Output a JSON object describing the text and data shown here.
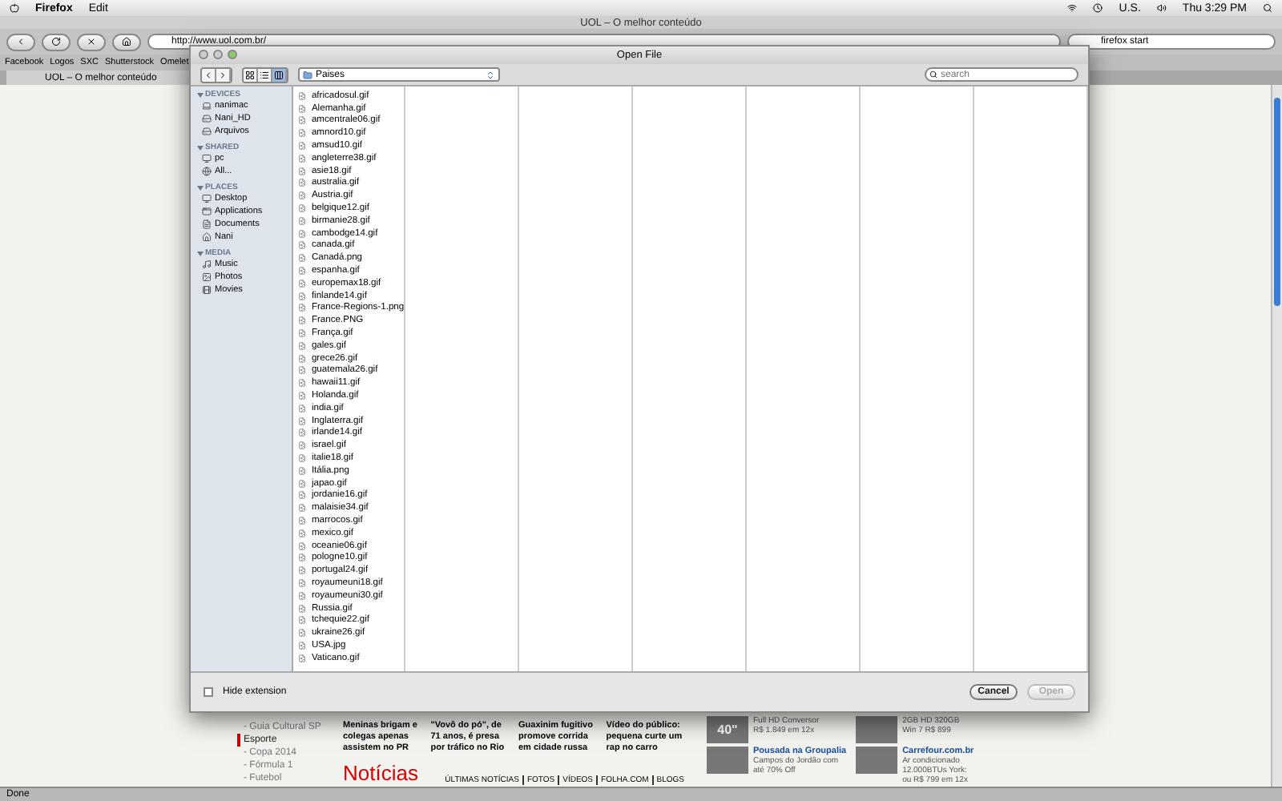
{
  "menubar": {
    "app": "Firefox",
    "menus": [
      "Edit"
    ],
    "input_source": "U.S.",
    "clock": "Thu 3:29 PM"
  },
  "browser": {
    "title": "UOL – O melhor conteúdo",
    "url": "http://www.uol.com.br/",
    "search_value": "firefox start",
    "bookmarks": [
      "Facebook",
      "Logos",
      "SXC",
      "Shutterstock",
      "Omelet"
    ],
    "tabs": [
      {
        "label": "UOL – O melhor conteúdo",
        "selected": true
      }
    ],
    "status": "Done"
  },
  "page": {
    "nav": [
      {
        "label": "- Guia Cultural SP",
        "kind": "sub"
      },
      {
        "label": "Esporte",
        "kind": "section"
      },
      {
        "label": "- Copa 2014",
        "kind": "sub"
      },
      {
        "label": "- Fórmula 1",
        "kind": "sub"
      },
      {
        "label": "- Futebol",
        "kind": "sub"
      }
    ],
    "stories": [
      "Meninas brigam e colegas apenas assistem no PR",
      "\"Vovô do pó\", de 71 anos, é presa por tráfico no Rio",
      "Guaxinim fugitivo promove corrida em cidade russa",
      "Vídeo do público: pequena curte um rap no carro"
    ],
    "section_title": "Notícias",
    "section_links": [
      "ÚLTIMAS NOTÍCIAS",
      "FOTOS",
      "VÍDEOS",
      "FOLHA.COM",
      "BLOGS"
    ],
    "ads": [
      {
        "badge": "40\"",
        "lines": [
          "Full HD Conversor",
          "R$ 1.849 em 12x"
        ]
      },
      {
        "lines": [
          "2GB HD 320GB",
          "Win 7 R$ 899"
        ]
      },
      {
        "title": "Pousada na Groupalia",
        "lines": [
          "Campos do Jordão com até 70% Off"
        ]
      },
      {
        "title": "Carrefour.com.br",
        "lines": [
          "Ar condicionado 12.000BTUs York: ou R$ 799 em 12x"
        ]
      }
    ]
  },
  "dialog": {
    "title": "Open File",
    "view_buttons": [
      {
        "kind": "icon",
        "selected": false
      },
      {
        "kind": "list",
        "selected": false
      },
      {
        "kind": "column",
        "selected": true
      }
    ],
    "location": "Paises",
    "search": {
      "placeholder": "search"
    },
    "sidebar": [
      {
        "heading": "DEVICES",
        "expanded": true,
        "items": [
          {
            "label": "nanimac",
            "kind": "computer"
          },
          {
            "label": "Nani_HD",
            "kind": "disk"
          },
          {
            "label": "Arquivos",
            "kind": "disk"
          }
        ]
      },
      {
        "heading": "SHARED",
        "expanded": true,
        "items": [
          {
            "label": "pc",
            "kind": "monitor"
          },
          {
            "label": "All...",
            "kind": "network"
          }
        ]
      },
      {
        "heading": "PLACES",
        "expanded": true,
        "items": [
          {
            "label": "Desktop",
            "kind": "desktop"
          },
          {
            "label": "Applications",
            "kind": "apps"
          },
          {
            "label": "Documents",
            "kind": "document"
          },
          {
            "label": "Nani",
            "kind": "home"
          }
        ]
      },
      {
        "heading": "MEDIA",
        "expanded": true,
        "items": [
          {
            "label": "Music",
            "kind": "music"
          },
          {
            "label": "Photos",
            "kind": "photos"
          },
          {
            "label": "Movies",
            "kind": "movies"
          }
        ]
      }
    ],
    "files": [
      "africadosul.gif",
      "Alemanha.gif",
      "amcentrale06.gif",
      "amnord10.gif",
      "amsud10.gif",
      "angleterre38.gif",
      "asie18.gif",
      "australia.gif",
      "Austria.gif",
      "belgique12.gif",
      "birmanie28.gif",
      "cambodge14.gif",
      "canada.gif",
      "Canadá.png",
      "espanha.gif",
      "europemax18.gif",
      "finlande14.gif",
      "France-Regions-1.png",
      "France.PNG",
      "França.gif",
      "gales.gif",
      "grece26.gif",
      "guatemala26.gif",
      "hawaii11.gif",
      "Holanda.gif",
      "india.gif",
      "Inglaterra.gif",
      "irlande14.gif",
      "israel.gif",
      "italie18.gif",
      "Itália.png",
      "japao.gif",
      "jordanie16.gif",
      "malaisie34.gif",
      "marrocos.gif",
      "mexico.gif",
      "oceanie06.gif",
      "pologne10.gif",
      "portugal24.gif",
      "royaumeuni18.gif",
      "royaumeuni30.gif",
      "Russia.gif",
      "tchequie22.gif",
      "ukraine26.gif",
      "USA.jpg",
      "Vaticano.gif"
    ],
    "hide_extension": {
      "label": "Hide extension",
      "checked": false
    },
    "buttons": [
      {
        "label": "Cancel",
        "disabled": false
      },
      {
        "label": "Open",
        "disabled": true
      }
    ]
  }
}
